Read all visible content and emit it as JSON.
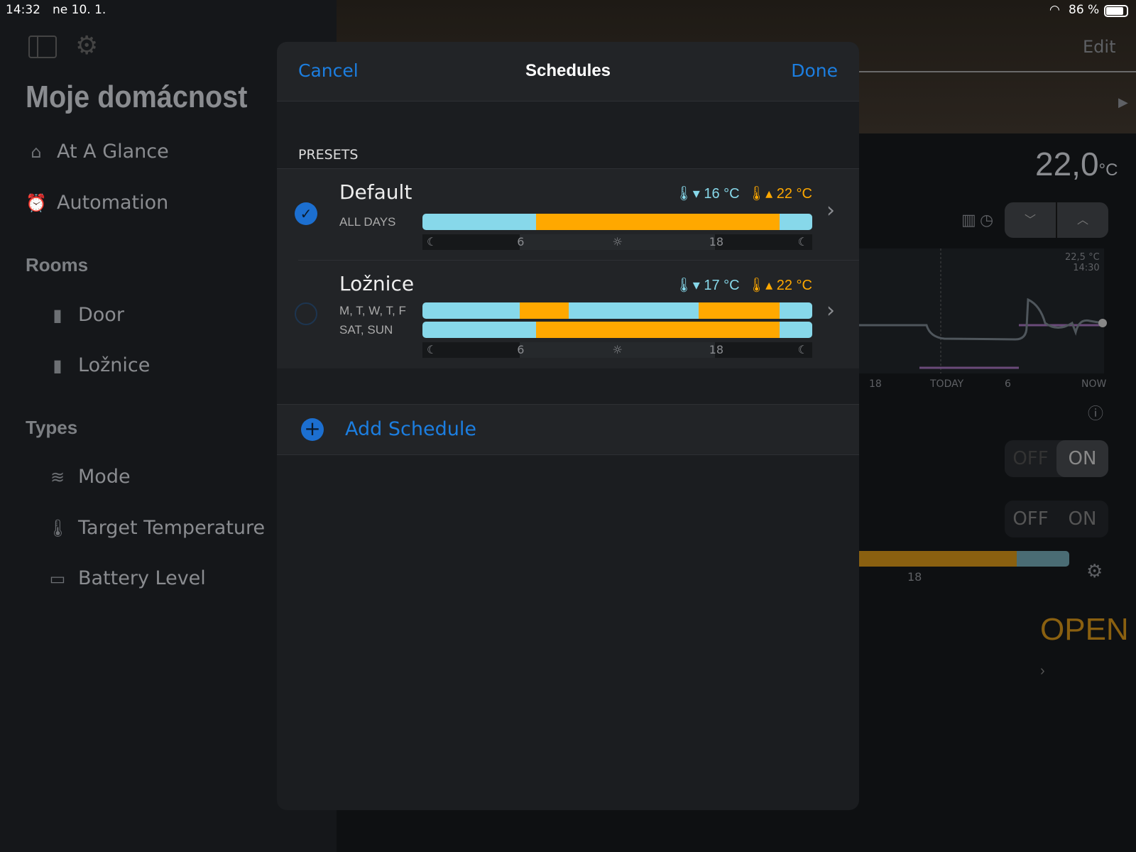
{
  "status": {
    "time": "14:32",
    "date": "ne 10. 1.",
    "battery": "86 %",
    "wifi_icon": "wifi-icon",
    "battery_icon": "battery-icon"
  },
  "sidebar": {
    "title": "Moje domácnost",
    "items": [
      {
        "label": "At A Glance",
        "icon": "home-icon"
      },
      {
        "label": "Automation",
        "icon": "automation-icon"
      }
    ],
    "rooms_header": "Rooms",
    "rooms": [
      {
        "label": "Door",
        "icon": "door-icon"
      },
      {
        "label": "Ložnice",
        "icon": "door-icon"
      }
    ],
    "types_header": "Types",
    "types": [
      {
        "label": "Mode",
        "icon": "heat-icon"
      },
      {
        "label": "Target Temperature",
        "icon": "thermometer-icon"
      },
      {
        "label": "Battery Level",
        "icon": "battery-icon"
      }
    ]
  },
  "background": {
    "edit": "Edit",
    "temperature": "22,0",
    "unit": "°C",
    "chart_value": "22,5 °C",
    "chart_time": "14:30",
    "axis": [
      "18",
      "TODAY",
      "6",
      "NOW"
    ],
    "toggle1": {
      "off": "OFF",
      "on": "ON"
    },
    "toggle2": {
      "off": "OFF",
      "on": "ON"
    },
    "timeline_18": "18",
    "open": "OPEN"
  },
  "modal": {
    "cancel": "Cancel",
    "title": "Schedules",
    "done": "Done",
    "section": "PRESETS",
    "colors": {
      "cold": "#87d8ea",
      "warm": "#ffa800",
      "accent": "#1c7ee0"
    },
    "presets": [
      {
        "name": "Default",
        "selected": true,
        "low": "16 °C",
        "high": "22 °C",
        "schedules": [
          {
            "days": "ALL DAYS",
            "warm_hours": [
              [
                7,
                22
              ]
            ]
          }
        ]
      },
      {
        "name": "Ložnice",
        "selected": false,
        "low": "17 °C",
        "high": "22 °C",
        "schedules": [
          {
            "days": "M, T, W, T, F",
            "warm_hours": [
              [
                6,
                9
              ],
              [
                17,
                22
              ]
            ]
          },
          {
            "days": "SAT, SUN",
            "warm_hours": [
              [
                7,
                22
              ]
            ]
          }
        ]
      }
    ],
    "timeline": {
      "t6": "6",
      "t18": "18"
    },
    "add": "Add Schedule"
  }
}
